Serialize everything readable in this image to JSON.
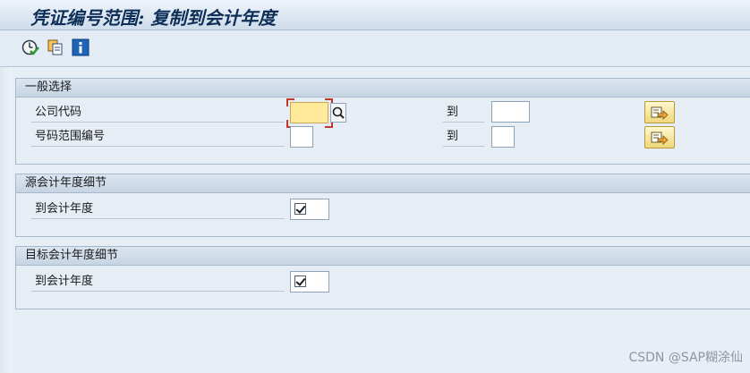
{
  "window": {
    "title": "凭证编号范围: 复制到会计年度"
  },
  "toolbar": {
    "icons": [
      "execute-icon",
      "copy-icon",
      "info-icon"
    ]
  },
  "groups": {
    "general": {
      "header": "一般选择",
      "company_code": {
        "label": "公司代码",
        "value": "",
        "to_label": "到",
        "to_value": ""
      },
      "number_range": {
        "label": "号码范围编号",
        "value": "",
        "to_label": "到",
        "to_value": ""
      }
    },
    "source_year": {
      "header": "源会计年度细节",
      "to_fiscal_year": {
        "label": "到会计年度",
        "checked": true
      }
    },
    "target_year": {
      "header": "目标会计年度细节",
      "to_fiscal_year": {
        "label": "到会计年度",
        "checked": true
      }
    }
  },
  "watermark": "CSDN @SAP糊涂仙",
  "colors": {
    "title_text": "#0d2f57",
    "required_field": "#ffe99a",
    "multiple_selection_button": "#f0d77a"
  }
}
